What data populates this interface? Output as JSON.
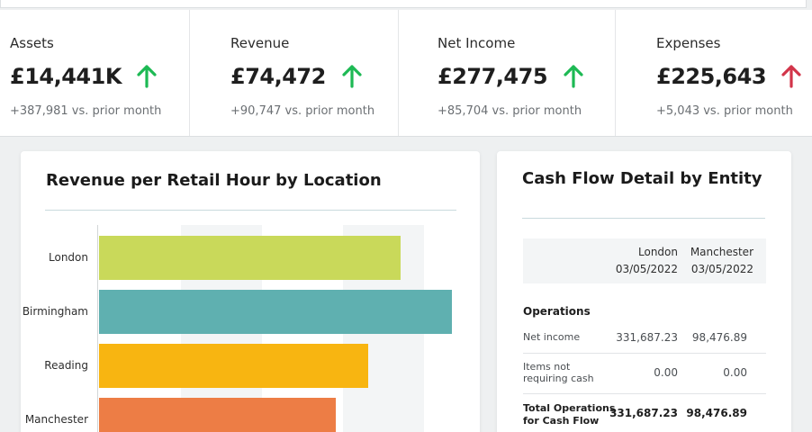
{
  "kpis": [
    {
      "label": "Assets",
      "value": "£14,441K",
      "delta": "+387,981 vs. prior month",
      "trend": "up"
    },
    {
      "label": "Revenue",
      "value": "£74,472",
      "delta": "+90,747 vs. prior month",
      "trend": "up"
    },
    {
      "label": "Net Income",
      "value": "£277,475",
      "delta": "+85,704 vs. prior month",
      "trend": "up"
    },
    {
      "label": "Expenses",
      "value": "£225,643",
      "delta": "+5,043 vs. prior month",
      "trend": "up-bad"
    }
  ],
  "colors": {
    "up": "#1db954",
    "up_bad": "#d2354a"
  },
  "revenue_chart": {
    "title": "Revenue per Retail Hour by Location"
  },
  "chart_data": {
    "type": "bar",
    "orientation": "horizontal",
    "title": "Revenue per Retail Hour by Location",
    "categories": [
      "London",
      "Birmingham",
      "Reading",
      "Manchester"
    ],
    "values": [
      338,
      396,
      302,
      266
    ],
    "colors": [
      "#c9d95a",
      "#5fb0b0",
      "#f8b511",
      "#ed7d45"
    ],
    "xlim": [
      0,
      400
    ],
    "grid": "alternating vertical bands"
  },
  "cash_flow": {
    "title": "Cash Flow Detail by Entity",
    "columns": [
      {
        "entity": "London",
        "date": "03/05/2022"
      },
      {
        "entity": "Manchester",
        "date": "03/05/2022"
      }
    ],
    "section": "Operations",
    "rows": [
      {
        "label": "Net income",
        "values": [
          "331,687.23",
          "98,476.89"
        ]
      },
      {
        "label_line1": "Items not",
        "label_line2": "requiring cash",
        "values": [
          "0.00",
          "0.00"
        ]
      },
      {
        "label_line1": "Total Operations",
        "label_line2": "for Cash Flow",
        "values": [
          "331,687.23",
          "98,476.89"
        ],
        "bold": true
      }
    ]
  }
}
